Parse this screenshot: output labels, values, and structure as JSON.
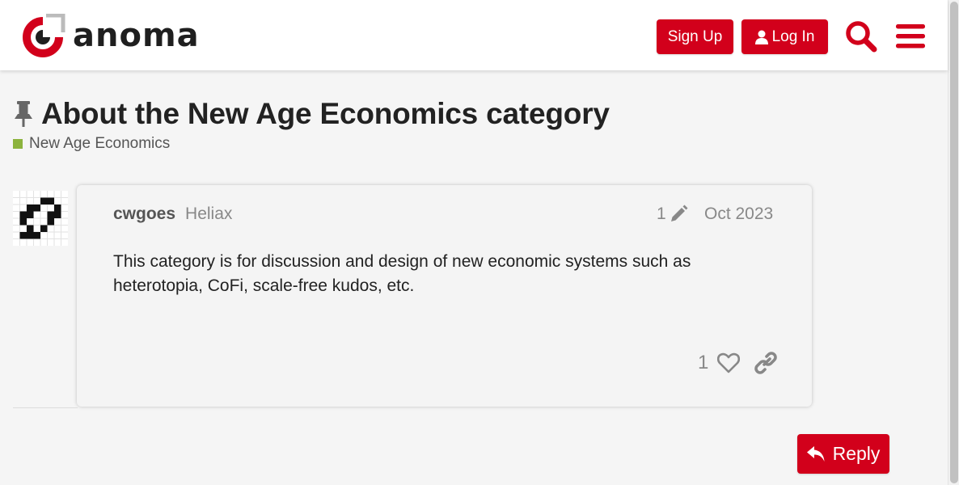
{
  "header": {
    "logo_text": "anoma",
    "signup_label": "Sign Up",
    "login_label": "Log In"
  },
  "topic": {
    "title": "About the New Age Economics category",
    "category": "New Age Economics",
    "category_color": "#8cb33d"
  },
  "post": {
    "username": "cwgoes",
    "user_title": "Heliax",
    "edit_count": "1",
    "date": "Oct 2023",
    "body": "This category is for discussion and design of new economic systems such as heterotopia, CoFi, scale-free kudos, etc.",
    "like_count": "1"
  },
  "actions": {
    "reply_label": "Reply"
  },
  "colors": {
    "brand_red": "#d2001b"
  },
  "icons": [
    "pin-icon",
    "user-icon",
    "search-icon",
    "hamburger-menu-icon",
    "pencil-icon",
    "heart-icon",
    "link-icon",
    "reply-arrow-icon"
  ]
}
